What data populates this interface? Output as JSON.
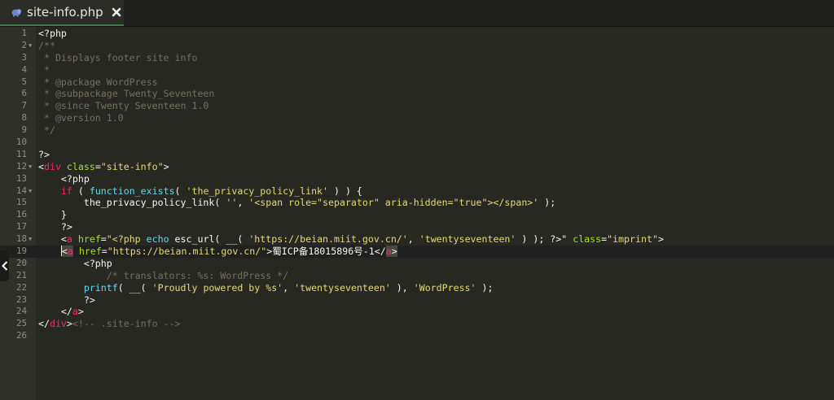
{
  "tab": {
    "filename": "site-info.php",
    "close_glyph": "✖",
    "file_icon": "php-elephant-icon"
  },
  "colors": {
    "background": "#272822",
    "gutter": "#2f3129",
    "tab_accent": "#3a7d44",
    "comment": "#75715e",
    "keyword": "#f92672",
    "function": "#66d9ef",
    "string": "#e6db74",
    "attribute": "#a6e22e"
  },
  "editor": {
    "active_line": 19,
    "lines": [
      {
        "n": "1",
        "fold": false,
        "tokens": [
          {
            "t": "<?php",
            "c": "pl"
          }
        ]
      },
      {
        "n": "2",
        "fold": true,
        "tokens": [
          {
            "t": "/**",
            "c": "cm"
          }
        ]
      },
      {
        "n": "3",
        "fold": false,
        "tokens": [
          {
            "t": " * Displays footer site info",
            "c": "cm"
          }
        ]
      },
      {
        "n": "4",
        "fold": false,
        "tokens": [
          {
            "t": " *",
            "c": "cm"
          }
        ]
      },
      {
        "n": "5",
        "fold": false,
        "tokens": [
          {
            "t": " * @package WordPress",
            "c": "cm"
          }
        ]
      },
      {
        "n": "6",
        "fold": false,
        "tokens": [
          {
            "t": " * @subpackage Twenty_Seventeen",
            "c": "cm"
          }
        ]
      },
      {
        "n": "7",
        "fold": false,
        "tokens": [
          {
            "t": " * @since Twenty Seventeen 1.0",
            "c": "cm"
          }
        ]
      },
      {
        "n": "8",
        "fold": false,
        "tokens": [
          {
            "t": " * @version 1.0",
            "c": "cm"
          }
        ]
      },
      {
        "n": "9",
        "fold": false,
        "tokens": [
          {
            "t": " */",
            "c": "cm"
          }
        ]
      },
      {
        "n": "10",
        "fold": false,
        "tokens": []
      },
      {
        "n": "11",
        "fold": false,
        "tokens": [
          {
            "t": "?>",
            "c": "pl"
          }
        ]
      },
      {
        "n": "12",
        "fold": true,
        "tokens": [
          {
            "t": "<",
            "c": "pl"
          },
          {
            "t": "div",
            "c": "kw"
          },
          {
            "t": " ",
            "c": "pl"
          },
          {
            "t": "class",
            "c": "at"
          },
          {
            "t": "=",
            "c": "pl"
          },
          {
            "t": "\"site-info\"",
            "c": "st"
          },
          {
            "t": ">",
            "c": "pl"
          }
        ]
      },
      {
        "n": "13",
        "fold": false,
        "tokens": [
          {
            "t": "    <?php",
            "c": "pl"
          }
        ]
      },
      {
        "n": "14",
        "fold": true,
        "tokens": [
          {
            "t": "    ",
            "c": "pl"
          },
          {
            "t": "if",
            "c": "kw"
          },
          {
            "t": " ( ",
            "c": "pl"
          },
          {
            "t": "function_exists",
            "c": "fn"
          },
          {
            "t": "( ",
            "c": "pl"
          },
          {
            "t": "'the_privacy_policy_link'",
            "c": "st"
          },
          {
            "t": " ) ) {",
            "c": "pl"
          }
        ]
      },
      {
        "n": "15",
        "fold": false,
        "tokens": [
          {
            "t": "        the_privacy_policy_link( ",
            "c": "pl"
          },
          {
            "t": "''",
            "c": "st"
          },
          {
            "t": ", ",
            "c": "pl"
          },
          {
            "t": "'<span role=\"separator\" aria-hidden=\"true\"></span>'",
            "c": "st"
          },
          {
            "t": " );",
            "c": "pl"
          }
        ]
      },
      {
        "n": "16",
        "fold": false,
        "tokens": [
          {
            "t": "    }",
            "c": "pl"
          }
        ]
      },
      {
        "n": "17",
        "fold": false,
        "tokens": [
          {
            "t": "    ?>",
            "c": "pl"
          }
        ]
      },
      {
        "n": "18",
        "fold": true,
        "tokens": [
          {
            "t": "    <",
            "c": "pl"
          },
          {
            "t": "a",
            "c": "kw"
          },
          {
            "t": " ",
            "c": "pl"
          },
          {
            "t": "href",
            "c": "at"
          },
          {
            "t": "=",
            "c": "pl"
          },
          {
            "t": "\"<?php ",
            "c": "st"
          },
          {
            "t": "echo",
            "c": "fn"
          },
          {
            "t": " esc_url( __( ",
            "c": "pl"
          },
          {
            "t": "'https://beian.miit.gov.cn/'",
            "c": "st"
          },
          {
            "t": ", ",
            "c": "pl"
          },
          {
            "t": "'twentyseventeen'",
            "c": "st"
          },
          {
            "t": " ) ); ?>\"",
            "c": "pl"
          },
          {
            "t": " ",
            "c": "pl"
          },
          {
            "t": "class",
            "c": "at"
          },
          {
            "t": "=",
            "c": "pl"
          },
          {
            "t": "\"imprint\"",
            "c": "st"
          },
          {
            "t": ">",
            "c": "pl"
          }
        ]
      },
      {
        "n": "19",
        "fold": false,
        "tokens": [
          {
            "t": "    ",
            "c": "pl"
          },
          {
            "t": "CURSOR",
            "c": "cursor"
          },
          {
            "t": "<",
            "c": "pl hl"
          },
          {
            "t": "a",
            "c": "kw hl"
          },
          {
            "t": " ",
            "c": "pl"
          },
          {
            "t": "href",
            "c": "at"
          },
          {
            "t": "=",
            "c": "pl"
          },
          {
            "t": "\"https://beian.miit.gov.cn/\"",
            "c": "st"
          },
          {
            "t": ">蜀ICP备18015896号-1</",
            "c": "pl"
          },
          {
            "t": "a",
            "c": "kw hl"
          },
          {
            "t": ">",
            "c": "pl hl"
          }
        ]
      },
      {
        "n": "20",
        "fold": false,
        "tokens": [
          {
            "t": "        <?php",
            "c": "pl"
          }
        ]
      },
      {
        "n": "21",
        "fold": false,
        "tokens": [
          {
            "t": "            /* translators: %s: WordPress */",
            "c": "cm"
          }
        ]
      },
      {
        "n": "22",
        "fold": false,
        "tokens": [
          {
            "t": "        ",
            "c": "pl"
          },
          {
            "t": "printf",
            "c": "fn"
          },
          {
            "t": "( __( ",
            "c": "pl"
          },
          {
            "t": "'Proudly powered by %s'",
            "c": "st"
          },
          {
            "t": ", ",
            "c": "pl"
          },
          {
            "t": "'twentyseventeen'",
            "c": "st"
          },
          {
            "t": " ), ",
            "c": "pl"
          },
          {
            "t": "'WordPress'",
            "c": "st"
          },
          {
            "t": " );",
            "c": "pl"
          }
        ]
      },
      {
        "n": "23",
        "fold": false,
        "tokens": [
          {
            "t": "        ?>",
            "c": "pl"
          }
        ]
      },
      {
        "n": "24",
        "fold": false,
        "tokens": [
          {
            "t": "    </",
            "c": "pl"
          },
          {
            "t": "a",
            "c": "kw"
          },
          {
            "t": ">",
            "c": "pl"
          }
        ]
      },
      {
        "n": "25",
        "fold": false,
        "tokens": [
          {
            "t": "</",
            "c": "pl"
          },
          {
            "t": "div",
            "c": "kw"
          },
          {
            "t": ">",
            "c": "pl"
          },
          {
            "t": "<!-- .site-info -->",
            "c": "cm"
          }
        ]
      },
      {
        "n": "26",
        "fold": false,
        "tokens": []
      }
    ]
  }
}
